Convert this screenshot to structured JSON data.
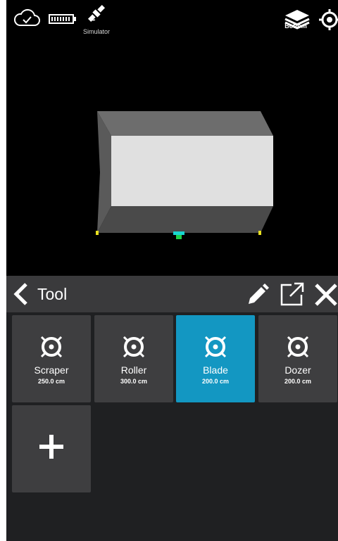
{
  "status_bar": {
    "cloud_icon": "cloud-check-icon",
    "battery_icon": "battery-icon",
    "gnss_icon": "satellite-icon",
    "gnss_label": "Simulator",
    "view_icon": "layers-icon",
    "view_label": "Bottom",
    "locate_icon": "crosshair-icon"
  },
  "panel": {
    "title": "Tool",
    "actions": [
      "edit-icon",
      "export-icon",
      "close-icon"
    ]
  },
  "tools": [
    {
      "name": "Scraper",
      "width": "250.0 cm",
      "selected": false
    },
    {
      "name": "Roller",
      "width": "300.0 cm",
      "selected": false
    },
    {
      "name": "Blade",
      "width": "200.0 cm",
      "selected": true
    },
    {
      "name": "Dozer",
      "width": "200.0 cm",
      "selected": false
    }
  ],
  "add_tool_icon": "plus-icon",
  "colors": {
    "accent": "#1397c2",
    "card": "#3e3e40",
    "panel_bg": "#1f2022",
    "header_bg": "#3a3a3c"
  }
}
